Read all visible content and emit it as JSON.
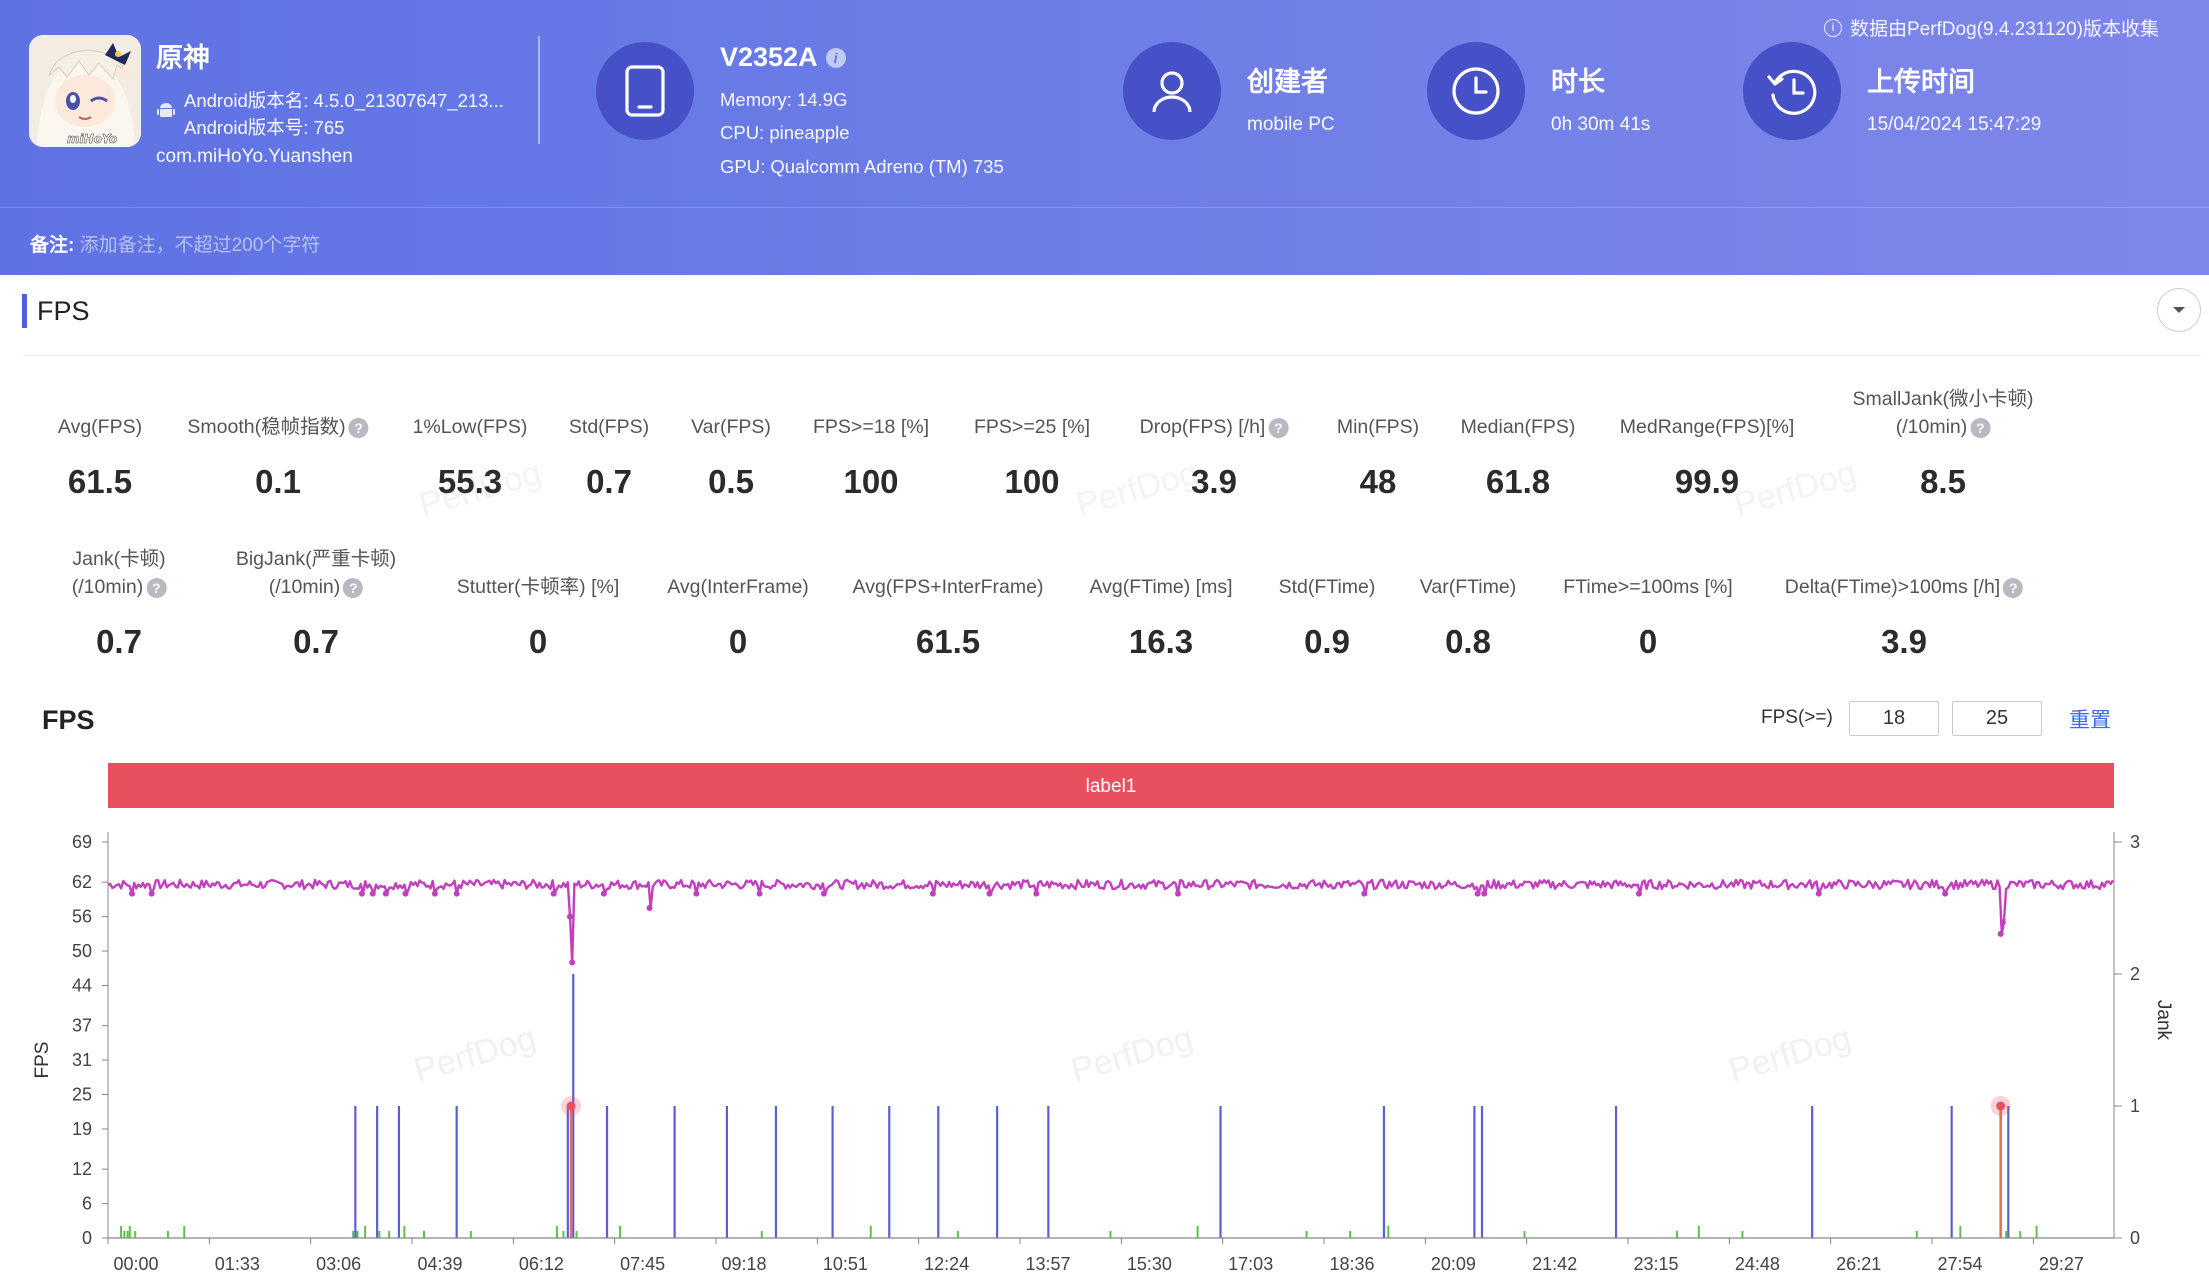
{
  "header": {
    "notice": "数据由PerfDog(9.4.231120)版本收集",
    "app": {
      "name": "原神",
      "version_name": "Android版本名: 4.5.0_21307647_213...",
      "version_code": "Android版本号: 765",
      "package": "com.miHoYo.Yuanshen",
      "icon_logo_text": "miHoYo"
    },
    "device": {
      "name": "V2352A",
      "info_icon": "i",
      "memory": "Memory: 14.9G",
      "cpu": "CPU: pineapple",
      "gpu": "GPU: Qualcomm Adreno (TM) 735"
    },
    "creator": {
      "label": "创建者",
      "value": "mobile PC"
    },
    "duration": {
      "label": "时长",
      "value": "0h 30m 41s"
    },
    "upload_time": {
      "label": "上传时间",
      "value": "15/04/2024 15:47:29"
    },
    "remark": {
      "label": "备注:",
      "placeholder": "添加备注，不超过200个字符"
    }
  },
  "section": {
    "title": "FPS"
  },
  "metrics_row1": [
    {
      "label": "Avg(FPS)",
      "value": "61.5"
    },
    {
      "label": "Smooth(稳帧指数)",
      "help": true,
      "value": "0.1"
    },
    {
      "label": "1%Low(FPS)",
      "value": "55.3"
    },
    {
      "label": "Std(FPS)",
      "value": "0.7"
    },
    {
      "label": "Var(FPS)",
      "value": "0.5"
    },
    {
      "label": "FPS>=18 [%]",
      "value": "100"
    },
    {
      "label": "FPS>=25 [%]",
      "value": "100"
    },
    {
      "label": "Drop(FPS) [/h]",
      "help": true,
      "value": "3.9"
    },
    {
      "label": "Min(FPS)",
      "value": "48"
    },
    {
      "label": "Median(FPS)",
      "value": "61.8"
    },
    {
      "label": "MedRange(FPS)[%]",
      "value": "99.9"
    },
    {
      "label": "SmallJank(微小卡顿)",
      "label2": "(/10min)",
      "help": true,
      "value": "8.5"
    }
  ],
  "metrics_row2": [
    {
      "label": "Jank(卡顿)",
      "label2": "(/10min)",
      "help": true,
      "value": "0.7"
    },
    {
      "label": "BigJank(严重卡顿)",
      "label2": "(/10min)",
      "help": true,
      "value": "0.7"
    },
    {
      "label": "Stutter(卡顿率) [%]",
      "value": "0"
    },
    {
      "label": "Avg(InterFrame)",
      "value": "0"
    },
    {
      "label": "Avg(FPS+InterFrame)",
      "value": "61.5"
    },
    {
      "label": "Avg(FTime) [ms]",
      "value": "16.3"
    },
    {
      "label": "Std(FTime)",
      "value": "0.9"
    },
    {
      "label": "Var(FTime)",
      "value": "0.8"
    },
    {
      "label": "FTime>=100ms [%]",
      "value": "0"
    },
    {
      "label": "Delta(FTime)>100ms [/h]",
      "help": true,
      "value": "3.9"
    }
  ],
  "help_glyph": "?",
  "watermark_text": "PerfDog",
  "chart_controls": {
    "title": "FPS",
    "threshold_label": "FPS(>=)",
    "threshold_values": [
      "18",
      "25"
    ],
    "reset_label": "重置"
  },
  "colors": {
    "header_start": "#5f72e4",
    "header_end": "#7f86ea",
    "icon_circle": "#4651c8",
    "label_band": "#e8505f",
    "fps_line": "#c23fbd",
    "jank_bar": "#5b5fd6",
    "bigjank_bar": "#e8705a",
    "small_jank": "#5fbf4a",
    "link": "#3a6ee8"
  },
  "chart_data": {
    "type": "line",
    "band_label": "label1",
    "xlabel": "",
    "ylabel": "FPS",
    "y2label": "Jank",
    "ylim": [
      0,
      69
    ],
    "y2lim": [
      0,
      3
    ],
    "yticks": [
      0,
      6,
      12,
      19,
      25,
      31,
      37,
      44,
      50,
      56,
      62,
      69
    ],
    "y2ticks": [
      0,
      1,
      2,
      3
    ],
    "xticks": [
      "00:00",
      "01:33",
      "03:06",
      "04:39",
      "06:12",
      "07:45",
      "09:18",
      "10:51",
      "12:24",
      "13:57",
      "15:30",
      "17:03",
      "18:36",
      "20:09",
      "21:42",
      "23:15",
      "24:48",
      "26:21",
      "27:54",
      "29:27"
    ],
    "x_range_s": [
      0,
      1841
    ],
    "fps_baseline": 61.6,
    "fps_dips": [
      {
        "t": 22,
        "fps": 60
      },
      {
        "t": 40,
        "fps": 60
      },
      {
        "t": 233,
        "fps": 60
      },
      {
        "t": 243,
        "fps": 60
      },
      {
        "t": 255,
        "fps": 60
      },
      {
        "t": 273,
        "fps": 60
      },
      {
        "t": 300,
        "fps": 60
      },
      {
        "t": 320,
        "fps": 60
      },
      {
        "t": 409,
        "fps": 60
      },
      {
        "t": 424,
        "fps": 56
      },
      {
        "t": 426,
        "fps": 48
      },
      {
        "t": 455,
        "fps": 60
      },
      {
        "t": 497,
        "fps": 57.5
      },
      {
        "t": 540,
        "fps": 60
      },
      {
        "t": 598,
        "fps": 60
      },
      {
        "t": 657,
        "fps": 60
      },
      {
        "t": 757,
        "fps": 60
      },
      {
        "t": 809,
        "fps": 60
      },
      {
        "t": 852,
        "fps": 60
      },
      {
        "t": 982,
        "fps": 60
      },
      {
        "t": 1153,
        "fps": 60
      },
      {
        "t": 1257,
        "fps": 60
      },
      {
        "t": 1263,
        "fps": 60
      },
      {
        "t": 1405,
        "fps": 60
      },
      {
        "t": 1570,
        "fps": 60
      },
      {
        "t": 1686,
        "fps": 60
      },
      {
        "t": 1737,
        "fps": 53
      },
      {
        "t": 1739,
        "fps": 55
      }
    ],
    "series": [
      {
        "name": "Jank",
        "values": [
          {
            "t": 227,
            "v": 1
          },
          {
            "t": 247,
            "v": 1
          },
          {
            "t": 267,
            "v": 1
          },
          {
            "t": 320,
            "v": 1
          },
          {
            "t": 422,
            "v": 1
          },
          {
            "t": 427,
            "v": 2
          },
          {
            "t": 458,
            "v": 1
          },
          {
            "t": 520,
            "v": 1
          },
          {
            "t": 568,
            "v": 1
          },
          {
            "t": 613,
            "v": 1
          },
          {
            "t": 665,
            "v": 1
          },
          {
            "t": 717,
            "v": 1
          },
          {
            "t": 762,
            "v": 1
          },
          {
            "t": 816,
            "v": 1
          },
          {
            "t": 863,
            "v": 1
          },
          {
            "t": 1021,
            "v": 1
          },
          {
            "t": 1171,
            "v": 1
          },
          {
            "t": 1254,
            "v": 1
          },
          {
            "t": 1261,
            "v": 1
          },
          {
            "t": 1384,
            "v": 1
          },
          {
            "t": 1564,
            "v": 1
          },
          {
            "t": 1692,
            "v": 1
          },
          {
            "t": 1744,
            "v": 1
          }
        ]
      },
      {
        "name": "BigJank",
        "values": [
          {
            "t": 425,
            "v": 1
          },
          {
            "t": 1737,
            "v": 1
          }
        ]
      }
    ]
  }
}
